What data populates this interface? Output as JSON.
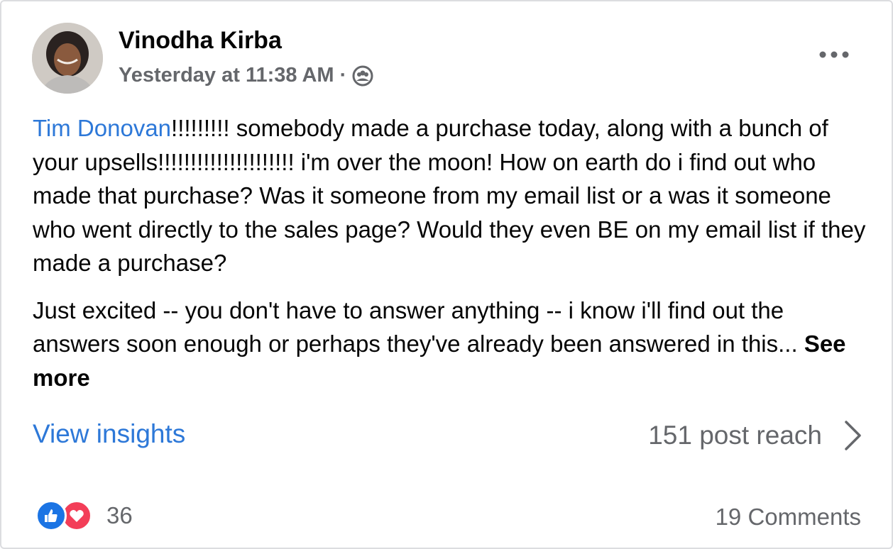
{
  "post": {
    "author_name": "Vinodha Kirba",
    "timestamp": "Yesterday at 11:38 AM",
    "separator": "·",
    "audience_icon": "group-audience-icon",
    "more_icon": "more-options-icon",
    "body": {
      "paragraph1": {
        "mention": "Tim Donovan",
        "text": "!!!!!!!!! somebody made a purchase today, along with a bunch of your upsells!!!!!!!!!!!!!!!!!!!!! i'm over the moon! How on earth do i find out who made that purchase? Was it someone from my email list or a was it someone who went directly to the sales page? Would they even BE on my email list if they made a purchase?"
      },
      "paragraph2": {
        "text": "Just excited -- you don't have to answer anything -- i know i'll find out the answers soon enough or perhaps they've already been answered in this... ",
        "see_more": "See more"
      }
    },
    "insights": {
      "link_label": "View insights",
      "reach_label": "151 post reach",
      "chevron_icon": "chevron-right-icon"
    },
    "footer": {
      "reaction_icons": [
        "like-icon",
        "love-icon"
      ],
      "reaction_count": "36",
      "comments_label": "19 Comments"
    }
  },
  "colors": {
    "link_blue": "#2d78d8",
    "secondary_text": "#65676b",
    "like_blue": "#1b74e4",
    "love_red": "#f33e58"
  }
}
